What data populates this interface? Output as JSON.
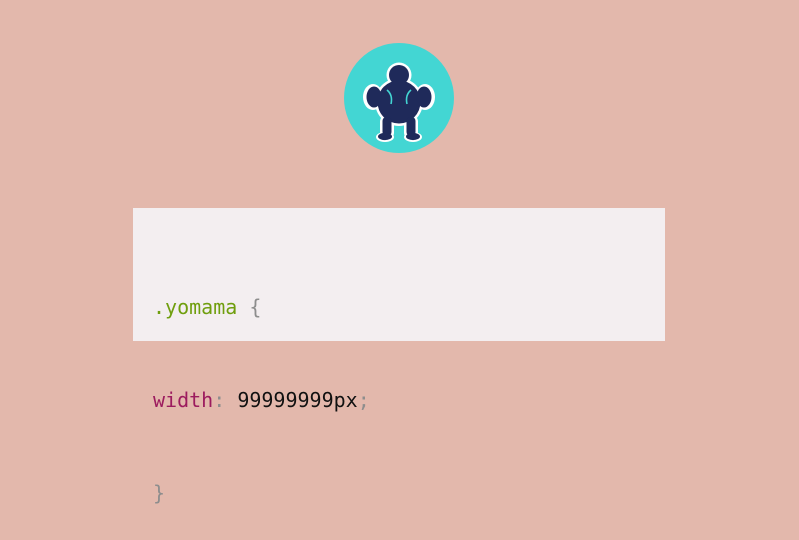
{
  "logo": {
    "icon": "sumo-silhouette-icon",
    "circle_color": "#43d6d3",
    "figure_color": "#1f2a5a"
  },
  "code": {
    "selector": ".yomama",
    "open_brace": "{",
    "property": "width",
    "colon": ":",
    "value": "99999999px",
    "semicolon": ";",
    "close_brace": "}"
  },
  "colors": {
    "background": "#e3b8ac",
    "card": "#f3eef0",
    "selector": "#6f9e0e",
    "property": "#9c1b5e",
    "punctuation": "#8d8d8d",
    "value": "#111111"
  }
}
